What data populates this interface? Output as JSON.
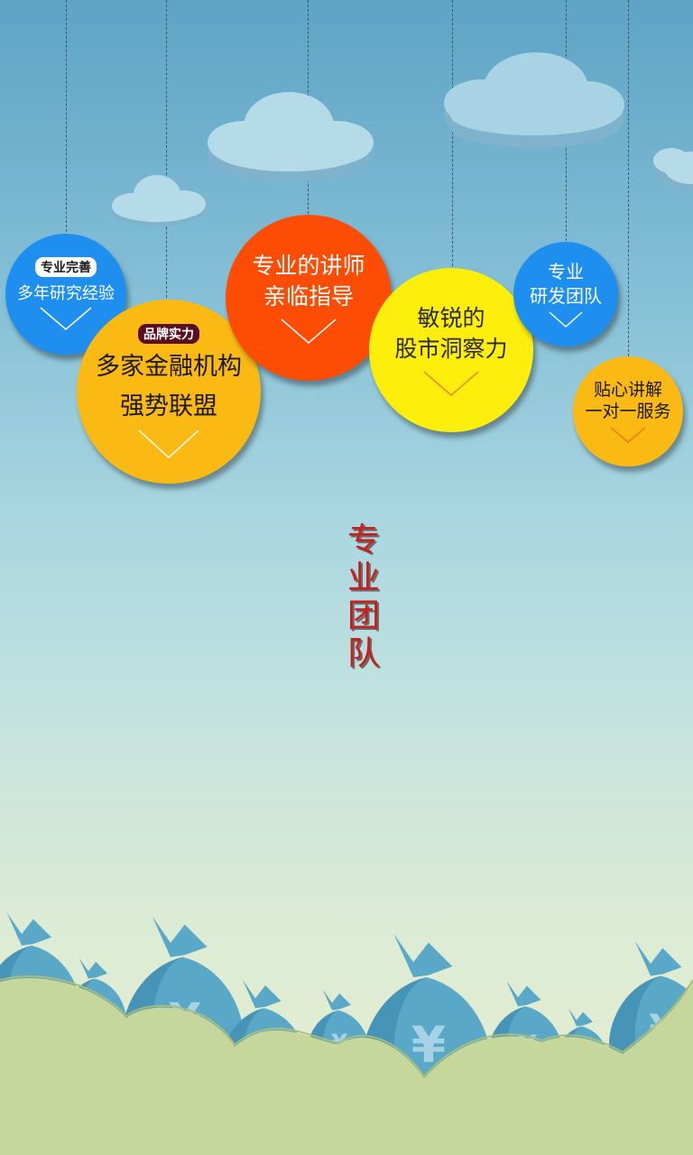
{
  "colors": {
    "blue": "#1e8fee",
    "orange_yellow": "#fbb913",
    "red_orange": "#fd4d05",
    "yellow": "#fdee0b",
    "title_red": "#c71e1e"
  },
  "bubbles": [
    {
      "id": "research",
      "badge": "专业完善",
      "lines": [
        "多年研究经验"
      ]
    },
    {
      "id": "brand",
      "badge": "品牌实力",
      "lines": [
        "多家金融机构",
        "强势联盟"
      ]
    },
    {
      "id": "lecturer",
      "lines": [
        "专业的讲师",
        "亲临指导"
      ]
    },
    {
      "id": "insight",
      "lines": [
        "敏锐的",
        "股市洞察力"
      ]
    },
    {
      "id": "team",
      "lines": [
        "专业",
        "研发团队"
      ]
    },
    {
      "id": "service",
      "lines": [
        "贴心讲解",
        "一对一服务"
      ]
    }
  ],
  "title_vertical": [
    "专",
    "业",
    "团",
    "队"
  ],
  "decor": {
    "bag_symbol": "¥",
    "icons": [
      "cloud-icon",
      "money-bag-icon",
      "chevron-down-icon"
    ]
  }
}
